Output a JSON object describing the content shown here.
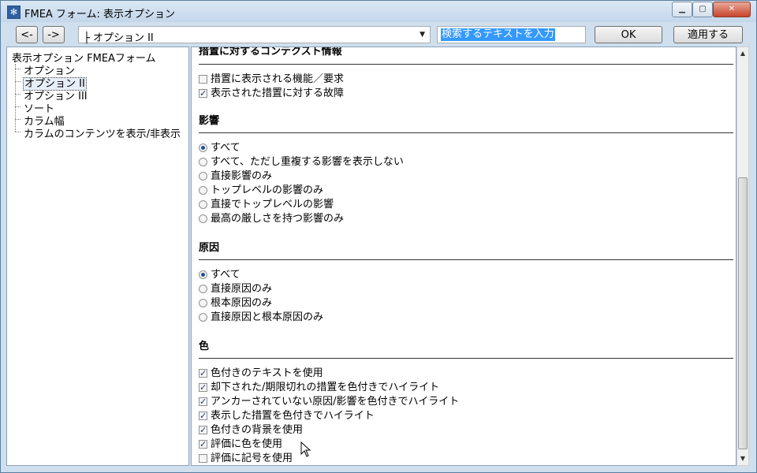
{
  "window": {
    "title": "FMEA フォーム: 表示オプション",
    "min_icon": "minimize-icon",
    "max_icon": "maximize-icon",
    "close_icon": "close-icon"
  },
  "toolbar": {
    "back_label": "<-",
    "forward_label": "->",
    "combo_value": "├ オプション II",
    "search_value": "検索するテキストを入力",
    "ok_label": "OK",
    "apply_label": "適用する"
  },
  "tree": {
    "root": "表示オプション FMEAフォーム",
    "items": [
      "オプション",
      "オプション II",
      "オプション III",
      "ソート",
      "カラム幅",
      "カラムのコンテンツを表示/非表示"
    ],
    "selected_index": 1
  },
  "sections": {
    "context": {
      "title": "措置に対するコンテクスト情報",
      "options": [
        {
          "label": "措置に表示される機能／要求",
          "checked": false
        },
        {
          "label": "表示された措置に対する故障",
          "checked": true
        }
      ]
    },
    "effects": {
      "title": "影響",
      "options": [
        {
          "label": "すべて",
          "checked": true
        },
        {
          "label": "すべて、ただし重複する影響を表示しない",
          "checked": false
        },
        {
          "label": "直接影響のみ",
          "checked": false
        },
        {
          "label": "トップレベルの影響のみ",
          "checked": false
        },
        {
          "label": "直接でトップレベルの影響",
          "checked": false
        },
        {
          "label": "最高の厳しさを持つ影響のみ",
          "checked": false
        }
      ]
    },
    "causes": {
      "title": "原因",
      "options": [
        {
          "label": "すべて",
          "checked": true
        },
        {
          "label": "直接原因のみ",
          "checked": false
        },
        {
          "label": "根本原因のみ",
          "checked": false
        },
        {
          "label": "直接原因と根本原因のみ",
          "checked": false
        }
      ]
    },
    "color": {
      "title": "色",
      "options": [
        {
          "label": "色付きのテキストを使用",
          "checked": true
        },
        {
          "label": "却下された/期限切れの措置を色付きでハイライト",
          "checked": true
        },
        {
          "label": "アンカーされていない原因/影響を色付きでハイライト",
          "checked": true
        },
        {
          "label": "表示した措置を色付きでハイライト",
          "checked": true
        },
        {
          "label": "色付きの背景を使用",
          "checked": true
        },
        {
          "label": "評価に色を使用",
          "checked": true
        },
        {
          "label": "評価に記号を使用",
          "checked": false
        }
      ]
    }
  }
}
